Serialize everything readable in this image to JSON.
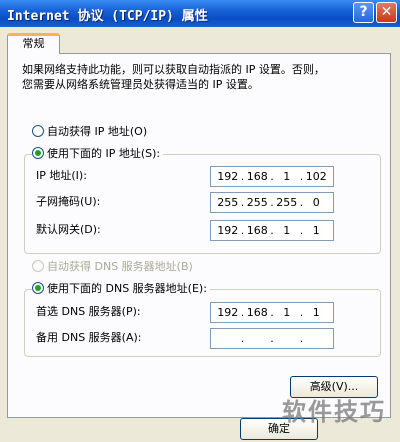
{
  "window": {
    "title": "Internet 协议 (TCP/IP) 属性",
    "help_button": "?",
    "close_button": "✕"
  },
  "tab": {
    "label": "常规"
  },
  "intro": {
    "line1": "如果网络支持此功能，则可以获取自动指派的 IP 设置。否则，",
    "line2": "您需要从网络系统管理员处获得适当的 IP 设置。"
  },
  "ip_section": {
    "auto_label": "自动获得 IP 地址(O)",
    "manual_label": "使用下面的 IP 地址(S):",
    "fields": [
      {
        "label": "IP 地址(I):",
        "octets": [
          "192",
          "168",
          "1",
          "102"
        ]
      },
      {
        "label": "子网掩码(U):",
        "octets": [
          "255",
          "255",
          "255",
          "0"
        ]
      },
      {
        "label": "默认网关(D):",
        "octets": [
          "192",
          "168",
          "1",
          "1"
        ]
      }
    ]
  },
  "dns_section": {
    "auto_label": "自动获得 DNS 服务器地址(B)",
    "manual_label": "使用下面的 DNS 服务器地址(E):",
    "fields": [
      {
        "label": "首选 DNS 服务器(P):",
        "octets": [
          "192",
          "168",
          "1",
          "1"
        ]
      },
      {
        "label": "备用 DNS 服务器(A):",
        "octets": [
          "",
          "",
          "",
          ""
        ]
      }
    ]
  },
  "buttons": {
    "advanced": "高级(V)...",
    "ok": "确定"
  },
  "watermark": "软件技巧"
}
